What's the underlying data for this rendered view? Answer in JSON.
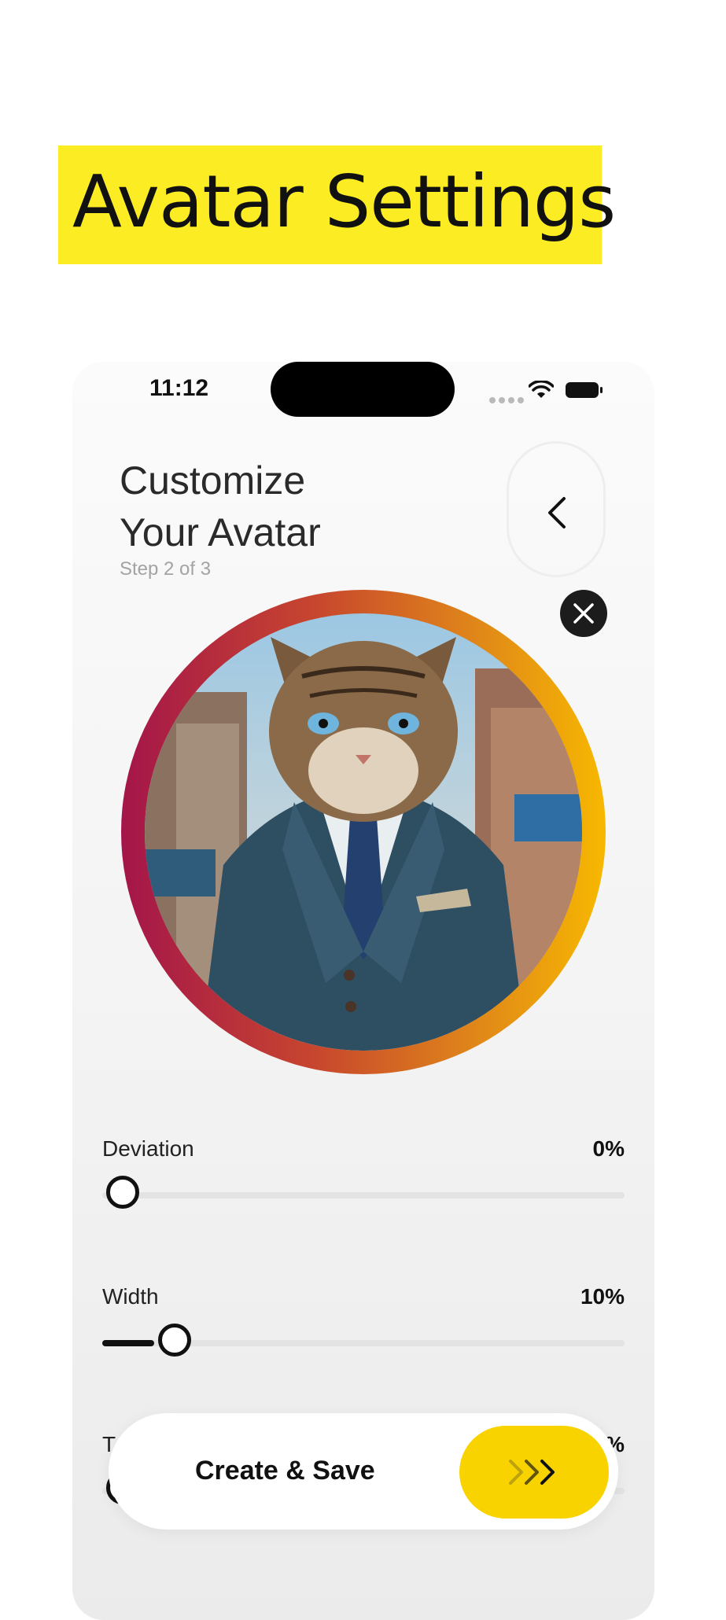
{
  "page": {
    "heading": "Avatar Settings"
  },
  "status_bar": {
    "time": "11:12"
  },
  "header": {
    "title_line1": "Customize",
    "title_line2": "Your Avatar",
    "step": "Step 2 of 3"
  },
  "sliders": [
    {
      "label": "Deviation",
      "value_text": "0%",
      "value": 0
    },
    {
      "label": "Width",
      "value_text": "10%",
      "value": 10
    },
    {
      "label": "T",
      "value_text": "%",
      "value": 0
    }
  ],
  "cta": {
    "label": "Create & Save"
  },
  "colors": {
    "highlight": "#fbec24",
    "ring_start": "#a4154a",
    "ring_end": "#f7b800",
    "cta_accent": "#f8d300"
  },
  "icons": [
    "back-chevron-icon",
    "close-icon",
    "wifi-icon",
    "battery-icon",
    "triple-chevron-icon"
  ]
}
